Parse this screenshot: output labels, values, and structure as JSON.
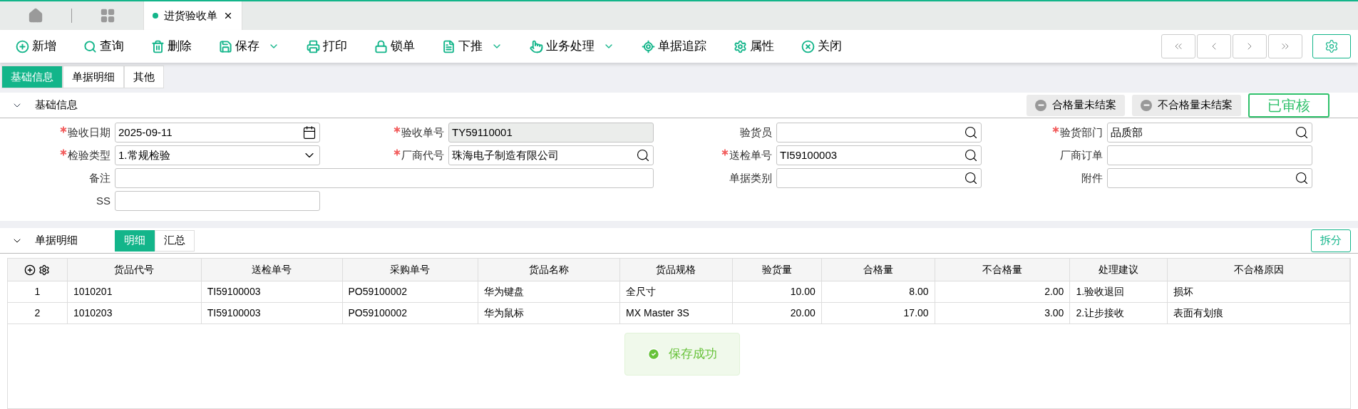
{
  "doc_tabs": [
    {
      "label": "进货验收单",
      "selected": true
    }
  ],
  "toolbar": [
    {
      "label": "新增",
      "dropdown": false
    },
    {
      "label": "查询",
      "dropdown": false
    },
    {
      "label": "删除",
      "dropdown": false
    },
    {
      "label": "保存",
      "dropdown": true
    },
    {
      "label": "打印",
      "dropdown": false
    },
    {
      "label": "锁单",
      "dropdown": false
    },
    {
      "label": "下推",
      "dropdown": true
    },
    {
      "label": "业务处理",
      "dropdown": true
    },
    {
      "label": "单据追踪",
      "dropdown": false
    },
    {
      "label": "属性",
      "dropdown": false
    },
    {
      "label": "关闭",
      "dropdown": false
    }
  ],
  "sub_tabs": [
    {
      "label": "基础信息",
      "selected": true
    },
    {
      "label": "单据明细",
      "selected": false
    },
    {
      "label": "其他",
      "selected": false
    }
  ],
  "basic_section": {
    "title": "基础信息",
    "expanded": true,
    "status_tags": [
      "合格量未结案",
      "不合格量未结案"
    ],
    "audit_stamp": "已审核",
    "fields": [
      {
        "label": "验收日期",
        "required": true,
        "kind": "date",
        "value": "2025-09-11"
      },
      {
        "label": "验收单号",
        "required": true,
        "kind": "readonly",
        "value": "TY59110001"
      },
      {
        "label": "验货员",
        "required": false,
        "kind": "lookup"
      },
      {
        "label": "验货部门",
        "required": true,
        "kind": "lookup",
        "value": "品质部"
      },
      {
        "label": "检验类型",
        "required": true,
        "kind": "select",
        "value": "1.常规检验"
      },
      {
        "label": "厂商代号",
        "required": true,
        "kind": "lookup",
        "value": "珠海电子制造有限公司"
      },
      {
        "label": "送检单号",
        "required": true,
        "kind": "lookup",
        "value": "TI59100003"
      },
      {
        "label": "厂商订单",
        "required": false,
        "kind": "text"
      },
      {
        "label": "备注",
        "required": false,
        "kind": "wide"
      },
      {
        "label": "单据类别",
        "required": false,
        "kind": "lookup"
      },
      {
        "label": "附件",
        "required": false,
        "kind": "lookup"
      },
      {
        "label": "SS",
        "required": false,
        "kind": "text"
      }
    ]
  },
  "detail_section": {
    "title": "单据明细",
    "expanded": true,
    "view_tabs": [
      {
        "label": "明细",
        "selected": true
      },
      {
        "label": "汇总",
        "selected": false
      }
    ],
    "split_button": "拆分",
    "table": {
      "columns": [
        "",
        "货品代号",
        "送检单号",
        "采购单号",
        "货品名称",
        "货品规格",
        "验货量",
        "合格量",
        "不合格量",
        "处理建议",
        "不合格原因"
      ],
      "rows": [
        [
          "1",
          "1010201",
          "TI59100003",
          "PO59100002",
          "华为键盘",
          "全尺寸",
          "10.00",
          "8.00",
          "2.00",
          "1.验收退回",
          "损坏"
        ],
        [
          "2",
          "1010203",
          "TI59100003",
          "PO59100002",
          "华为鼠标",
          "MX Master 3S",
          "20.00",
          "17.00",
          "3.00",
          "2.让步接收",
          "表面有划痕"
        ]
      ]
    }
  },
  "toast": "保存成功"
}
